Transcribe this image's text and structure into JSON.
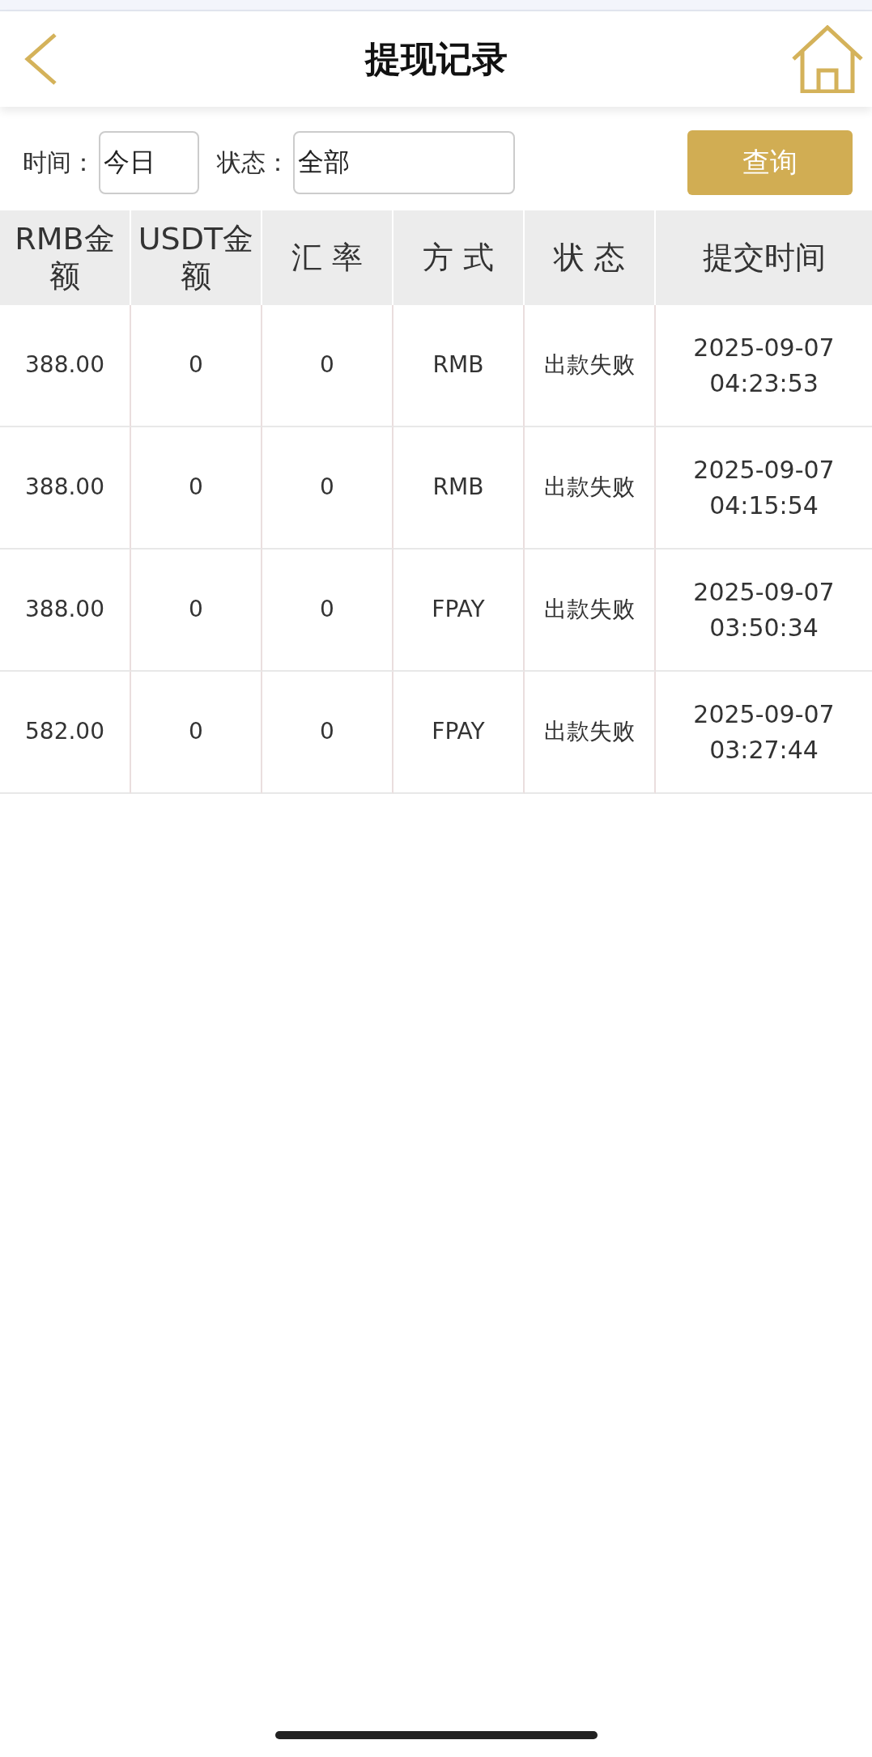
{
  "header": {
    "title": "提现记录"
  },
  "filters": [
    {
      "label": "时间：",
      "value": "今日"
    },
    {
      "label": "状态：",
      "value": "全部"
    }
  ],
  "query_button": "查询",
  "table": {
    "columns": [
      "RMB金额",
      "USDT金额",
      "汇 率",
      "方 式",
      "状 态",
      "提交时间"
    ],
    "rows": [
      [
        "388.00",
        "0",
        "0",
        "RMB",
        "出款失败",
        "2025-09-07 04:23:53"
      ],
      [
        "388.00",
        "0",
        "0",
        "RMB",
        "出款失败",
        "2025-09-07 04:15:54"
      ],
      [
        "388.00",
        "0",
        "0",
        "FPAY",
        "出款失败",
        "2025-09-07 03:50:34"
      ],
      [
        "582.00",
        "0",
        "0",
        "FPAY",
        "出款失败",
        "2025-09-07 03:27:44"
      ]
    ]
  }
}
